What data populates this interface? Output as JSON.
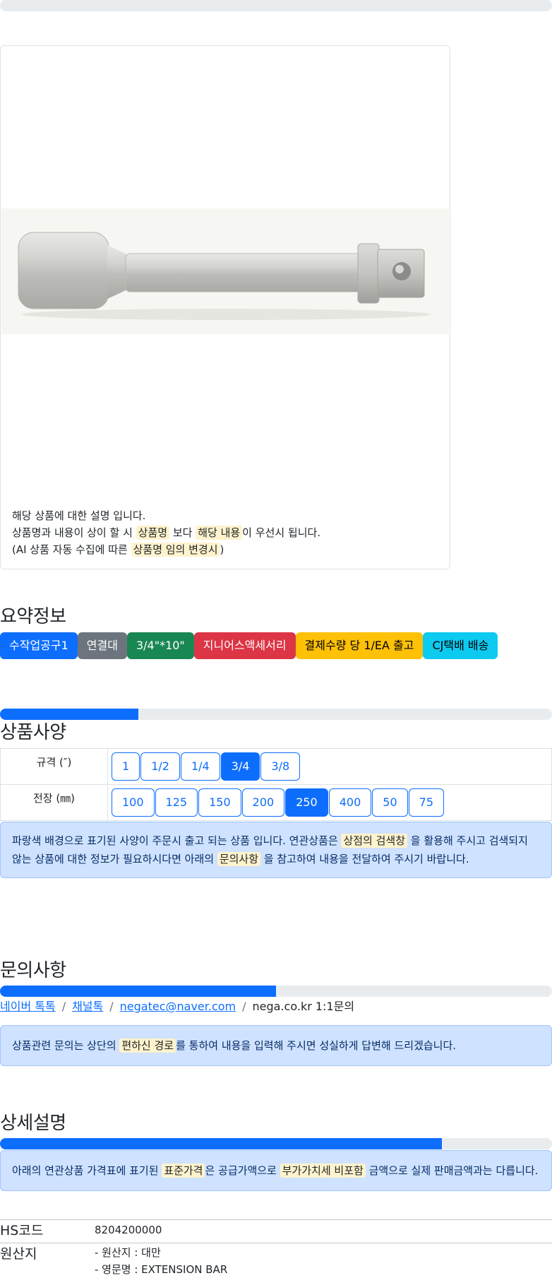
{
  "top_progress": {
    "fill_percent": 0
  },
  "product_image": {
    "alt": "socket extension bar"
  },
  "description_notice": {
    "line1": "해당 상품에 대한 설명 입니다.",
    "line2_pre": "상품명과 내용이 상이 할 시 ",
    "line2_hl1": "상품명",
    "line2_mid": " 보다 ",
    "line2_hl2": "해당 내용",
    "line2_post": "이 우선시 됩니다.",
    "line3_pre": "(AI 상품 자동 수집에 따른 ",
    "line3_hl": "상품명 임의 변경시",
    "line3_post": ")"
  },
  "summary": {
    "title": "요약정보",
    "badges": [
      {
        "label": "수작업공구1",
        "color": "#0d6efd",
        "text_color": "#ffffff"
      },
      {
        "label": "연결대",
        "color": "#6c757d",
        "text_color": "#ffffff"
      },
      {
        "label": "3/4\"*10\"",
        "color": "#198754",
        "text_color": "#ffffff"
      },
      {
        "label": "지니어스액세서리",
        "color": "#dc3545",
        "text_color": "#ffffff"
      },
      {
        "label": "결제수량 당 1/EA 출고",
        "color": "#ffc107",
        "text_color": "#000000"
      },
      {
        "label": "CJ택배 배송",
        "color": "#0dcaf0",
        "text_color": "#000000"
      }
    ]
  },
  "specs": {
    "progress_percent": 25,
    "title": "상품사양",
    "rows": [
      {
        "label": "규격 (″)",
        "options": [
          "1",
          "1/2",
          "1/4",
          "3/4",
          "3/8"
        ],
        "selected": "3/4"
      },
      {
        "label": "전장 (㎜)",
        "options": [
          "100",
          "125",
          "150",
          "200",
          "250",
          "400",
          "50",
          "75"
        ],
        "selected": "250"
      }
    ],
    "notice": {
      "pre": "파랑색 배경으로 표기된 사양이 주문시 출고 되는 상품 입니다. 연관상품은 ",
      "hl1": "상점의 검색창",
      "mid": " 을 활용해 주시고 검색되지 않는 상품에 대한 정보가 필요하시다면 아래의 ",
      "hl2": "문의사항",
      "post": " 을 참고하여 내용을 전달하여 주시기 바랍니다."
    }
  },
  "inquiry": {
    "title": "문의사항",
    "progress_percent": 50,
    "links": [
      "네이버 톡톡",
      "채널톡",
      "negatec@naver.com"
    ],
    "plain": "nega.co.kr 1:1문의",
    "separator": "/",
    "notice": {
      "pre": "상품관련 문의는 상단의 ",
      "hl": "편하신 경로",
      "post": "를 통하여 내용을 입력해 주시면 성실하게 답변해 드리겠습니다."
    }
  },
  "detail": {
    "title": "상세설명",
    "progress_percent": 80,
    "notice": {
      "pre": "아래의 연관상품 가격표에 표기된 ",
      "hl1": "표준가격",
      "mid": "은 공급가액으로 ",
      "hl2": "부가가치세 비포함",
      "post": " 금액으로 실제 판매금액과는 다릅니다."
    }
  },
  "info": {
    "hs_label": "HS코드",
    "hs_value": "8204200000",
    "origin_label": "원산지",
    "origin_lines": [
      "- 원산지 : 대만",
      "- 영문명 : EXTENSION BAR"
    ]
  }
}
